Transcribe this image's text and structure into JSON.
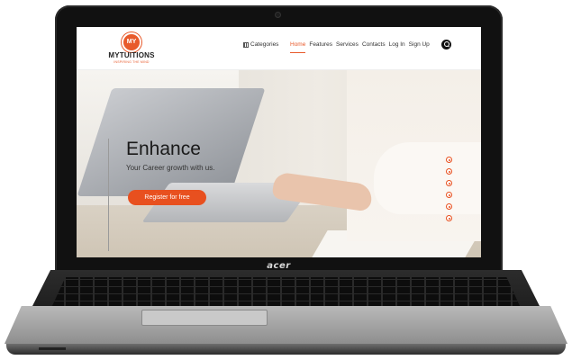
{
  "laptop": {
    "brand": "acer"
  },
  "site": {
    "logo": {
      "badge": "MY",
      "name": "MYTUITIONS",
      "tagline": "INSPIRING THE MIND",
      "accent": "#e85a2b"
    },
    "nav": {
      "categories_label": "Categories",
      "items": [
        "Home",
        "Features",
        "Services",
        "Contacts",
        "Log In",
        "Sign Up"
      ],
      "active": "Home",
      "search_icon": "search-icon"
    },
    "hero": {
      "title": "Enhance",
      "subtitle": "Your Career growth with us.",
      "cta_label": "Register for free",
      "cta_color": "#e8501f",
      "slider_dots": 6
    }
  }
}
